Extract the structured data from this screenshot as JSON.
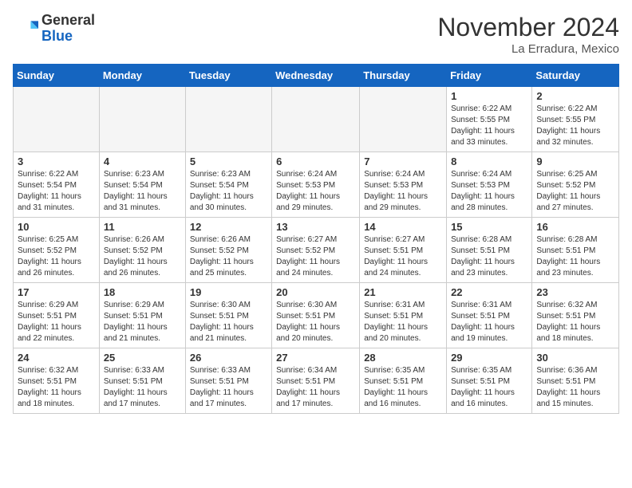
{
  "header": {
    "logo_general": "General",
    "logo_blue": "Blue",
    "month_title": "November 2024",
    "location": "La Erradura, Mexico"
  },
  "days_of_week": [
    "Sunday",
    "Monday",
    "Tuesday",
    "Wednesday",
    "Thursday",
    "Friday",
    "Saturday"
  ],
  "weeks": [
    [
      {
        "day": "",
        "empty": true
      },
      {
        "day": "",
        "empty": true
      },
      {
        "day": "",
        "empty": true
      },
      {
        "day": "",
        "empty": true
      },
      {
        "day": "",
        "empty": true
      },
      {
        "day": "1",
        "sunrise": "Sunrise: 6:22 AM",
        "sunset": "Sunset: 5:55 PM",
        "daylight": "Daylight: 11 hours and 33 minutes."
      },
      {
        "day": "2",
        "sunrise": "Sunrise: 6:22 AM",
        "sunset": "Sunset: 5:55 PM",
        "daylight": "Daylight: 11 hours and 32 minutes."
      }
    ],
    [
      {
        "day": "3",
        "sunrise": "Sunrise: 6:22 AM",
        "sunset": "Sunset: 5:54 PM",
        "daylight": "Daylight: 11 hours and 31 minutes."
      },
      {
        "day": "4",
        "sunrise": "Sunrise: 6:23 AM",
        "sunset": "Sunset: 5:54 PM",
        "daylight": "Daylight: 11 hours and 31 minutes."
      },
      {
        "day": "5",
        "sunrise": "Sunrise: 6:23 AM",
        "sunset": "Sunset: 5:54 PM",
        "daylight": "Daylight: 11 hours and 30 minutes."
      },
      {
        "day": "6",
        "sunrise": "Sunrise: 6:24 AM",
        "sunset": "Sunset: 5:53 PM",
        "daylight": "Daylight: 11 hours and 29 minutes."
      },
      {
        "day": "7",
        "sunrise": "Sunrise: 6:24 AM",
        "sunset": "Sunset: 5:53 PM",
        "daylight": "Daylight: 11 hours and 29 minutes."
      },
      {
        "day": "8",
        "sunrise": "Sunrise: 6:24 AM",
        "sunset": "Sunset: 5:53 PM",
        "daylight": "Daylight: 11 hours and 28 minutes."
      },
      {
        "day": "9",
        "sunrise": "Sunrise: 6:25 AM",
        "sunset": "Sunset: 5:52 PM",
        "daylight": "Daylight: 11 hours and 27 minutes."
      }
    ],
    [
      {
        "day": "10",
        "sunrise": "Sunrise: 6:25 AM",
        "sunset": "Sunset: 5:52 PM",
        "daylight": "Daylight: 11 hours and 26 minutes."
      },
      {
        "day": "11",
        "sunrise": "Sunrise: 6:26 AM",
        "sunset": "Sunset: 5:52 PM",
        "daylight": "Daylight: 11 hours and 26 minutes."
      },
      {
        "day": "12",
        "sunrise": "Sunrise: 6:26 AM",
        "sunset": "Sunset: 5:52 PM",
        "daylight": "Daylight: 11 hours and 25 minutes."
      },
      {
        "day": "13",
        "sunrise": "Sunrise: 6:27 AM",
        "sunset": "Sunset: 5:52 PM",
        "daylight": "Daylight: 11 hours and 24 minutes."
      },
      {
        "day": "14",
        "sunrise": "Sunrise: 6:27 AM",
        "sunset": "Sunset: 5:51 PM",
        "daylight": "Daylight: 11 hours and 24 minutes."
      },
      {
        "day": "15",
        "sunrise": "Sunrise: 6:28 AM",
        "sunset": "Sunset: 5:51 PM",
        "daylight": "Daylight: 11 hours and 23 minutes."
      },
      {
        "day": "16",
        "sunrise": "Sunrise: 6:28 AM",
        "sunset": "Sunset: 5:51 PM",
        "daylight": "Daylight: 11 hours and 23 minutes."
      }
    ],
    [
      {
        "day": "17",
        "sunrise": "Sunrise: 6:29 AM",
        "sunset": "Sunset: 5:51 PM",
        "daylight": "Daylight: 11 hours and 22 minutes."
      },
      {
        "day": "18",
        "sunrise": "Sunrise: 6:29 AM",
        "sunset": "Sunset: 5:51 PM",
        "daylight": "Daylight: 11 hours and 21 minutes."
      },
      {
        "day": "19",
        "sunrise": "Sunrise: 6:30 AM",
        "sunset": "Sunset: 5:51 PM",
        "daylight": "Daylight: 11 hours and 21 minutes."
      },
      {
        "day": "20",
        "sunrise": "Sunrise: 6:30 AM",
        "sunset": "Sunset: 5:51 PM",
        "daylight": "Daylight: 11 hours and 20 minutes."
      },
      {
        "day": "21",
        "sunrise": "Sunrise: 6:31 AM",
        "sunset": "Sunset: 5:51 PM",
        "daylight": "Daylight: 11 hours and 20 minutes."
      },
      {
        "day": "22",
        "sunrise": "Sunrise: 6:31 AM",
        "sunset": "Sunset: 5:51 PM",
        "daylight": "Daylight: 11 hours and 19 minutes."
      },
      {
        "day": "23",
        "sunrise": "Sunrise: 6:32 AM",
        "sunset": "Sunset: 5:51 PM",
        "daylight": "Daylight: 11 hours and 18 minutes."
      }
    ],
    [
      {
        "day": "24",
        "sunrise": "Sunrise: 6:32 AM",
        "sunset": "Sunset: 5:51 PM",
        "daylight": "Daylight: 11 hours and 18 minutes."
      },
      {
        "day": "25",
        "sunrise": "Sunrise: 6:33 AM",
        "sunset": "Sunset: 5:51 PM",
        "daylight": "Daylight: 11 hours and 17 minutes."
      },
      {
        "day": "26",
        "sunrise": "Sunrise: 6:33 AM",
        "sunset": "Sunset: 5:51 PM",
        "daylight": "Daylight: 11 hours and 17 minutes."
      },
      {
        "day": "27",
        "sunrise": "Sunrise: 6:34 AM",
        "sunset": "Sunset: 5:51 PM",
        "daylight": "Daylight: 11 hours and 17 minutes."
      },
      {
        "day": "28",
        "sunrise": "Sunrise: 6:35 AM",
        "sunset": "Sunset: 5:51 PM",
        "daylight": "Daylight: 11 hours and 16 minutes."
      },
      {
        "day": "29",
        "sunrise": "Sunrise: 6:35 AM",
        "sunset": "Sunset: 5:51 PM",
        "daylight": "Daylight: 11 hours and 16 minutes."
      },
      {
        "day": "30",
        "sunrise": "Sunrise: 6:36 AM",
        "sunset": "Sunset: 5:51 PM",
        "daylight": "Daylight: 11 hours and 15 minutes."
      }
    ]
  ]
}
